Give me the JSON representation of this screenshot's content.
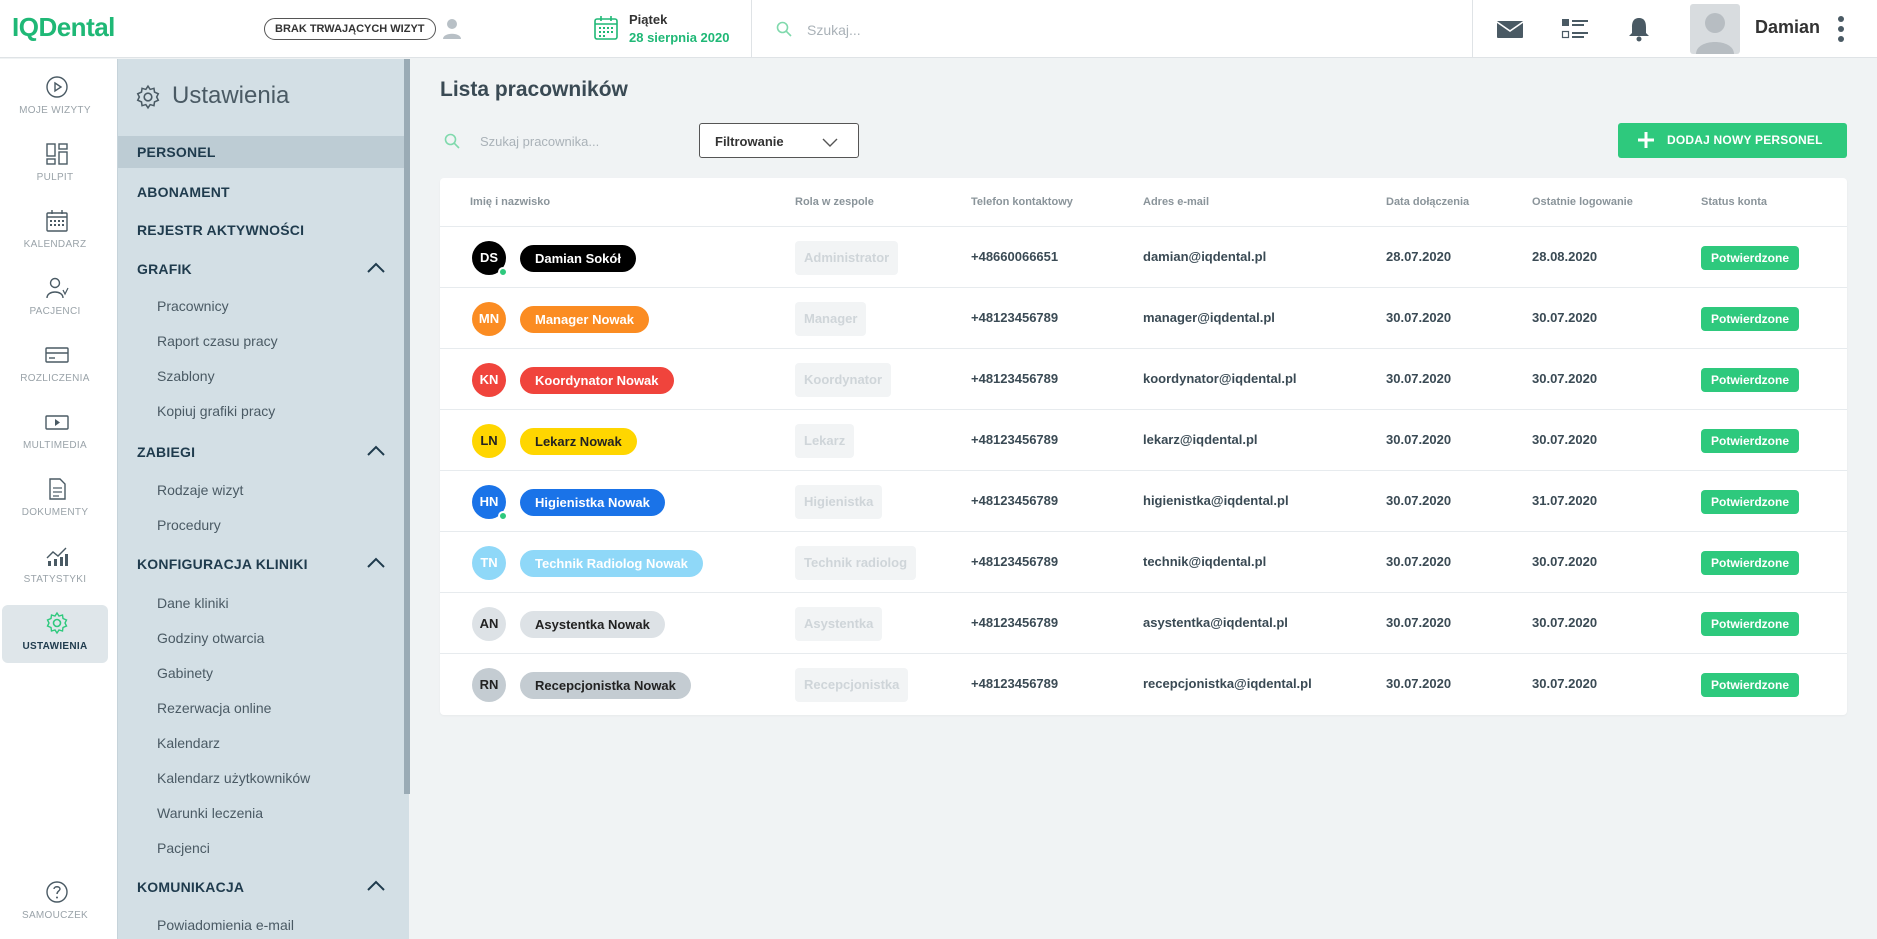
{
  "app": {
    "logo": "IQDental"
  },
  "topbar": {
    "visit_status": "BRAK TRWAJĄCYCH WIZYT",
    "date_day": "Piątek",
    "date_full": "28 sierpnia 2020",
    "search_placeholder": "Szukaj...",
    "username": "Damian"
  },
  "rail": [
    {
      "label": "MOJE WIZYTY",
      "icon": "play-circle-icon"
    },
    {
      "label": "PULPIT",
      "icon": "dashboard-icon"
    },
    {
      "label": "KALENDARZ",
      "icon": "calendar-icon"
    },
    {
      "label": "PACJENCI",
      "icon": "patients-icon"
    },
    {
      "label": "ROZLICZENIA",
      "icon": "card-icon"
    },
    {
      "label": "MULTIMEDIA",
      "icon": "media-icon"
    },
    {
      "label": "DOKUMENTY",
      "icon": "document-icon"
    },
    {
      "label": "STATYSTYKI",
      "icon": "stats-icon"
    },
    {
      "label": "USTAWIENIA",
      "icon": "gear-icon",
      "active": true
    },
    {
      "label": "SAMOUCZEK",
      "icon": "help-icon"
    }
  ],
  "settings": {
    "title": "Ustawienia",
    "sections": {
      "personel": "PERSONEL",
      "abonament": "ABONAMENT",
      "rejestr": "REJESTR AKTYWNOŚCI",
      "grafik": "GRAFIK",
      "zabiegi": "ZABIEGI",
      "konfiguracja": "KONFIGURACJA KLINIKI",
      "komunikacja": "KOMUNIKACJA"
    },
    "grafik_items": [
      "Pracownicy",
      "Raport czasu pracy",
      "Szablony",
      "Kopiuj grafiki pracy"
    ],
    "zabiegi_items": [
      "Rodzaje wizyt",
      "Procedury"
    ],
    "konfiguracja_items": [
      "Dane kliniki",
      "Godziny otwarcia",
      "Gabinety",
      "Rezerwacja online",
      "Kalendarz",
      "Kalendarz użytkowników",
      "Warunki leczenia",
      "Pacjenci"
    ],
    "komunikacja_items": [
      "Powiadomienia e-mail"
    ]
  },
  "main": {
    "title": "Lista pracowników",
    "search_placeholder": "Szukaj pracownika...",
    "filter_label": "Filtrowanie",
    "add_label": "DODAJ NOWY PERSONEL",
    "columns": [
      "Imię i nazwisko",
      "Rola w zespole",
      "Telefon kontaktowy",
      "Adres e-mail",
      "Data dołączenia",
      "Ostatnie logowanie",
      "Status konta"
    ],
    "rows": [
      {
        "initials": "DS",
        "name": "Damian Sokół",
        "role": "Administrator",
        "phone": "+48660066651",
        "email": "damian@iqdental.pl",
        "joined": "28.07.2020",
        "last_login": "28.08.2020",
        "status": "Potwierdzone",
        "color": "#000000",
        "text_color": "#ffffff",
        "online": true
      },
      {
        "initials": "MN",
        "name": "Manager Nowak",
        "role": "Manager",
        "phone": "+48123456789",
        "email": "manager@iqdental.pl",
        "joined": "30.07.2020",
        "last_login": "30.07.2020",
        "status": "Potwierdzone",
        "color": "#fb8c22",
        "text_color": "#ffffff",
        "online": false
      },
      {
        "initials": "KN",
        "name": "Koordynator Nowak",
        "role": "Koordynator",
        "phone": "+48123456789",
        "email": "koordynator@iqdental.pl",
        "joined": "30.07.2020",
        "last_login": "30.07.2020",
        "status": "Potwierdzone",
        "color": "#f0443c",
        "text_color": "#ffffff",
        "online": false
      },
      {
        "initials": "LN",
        "name": "Lekarz Nowak",
        "role": "Lekarz",
        "phone": "+48123456789",
        "email": "lekarz@iqdental.pl",
        "joined": "30.07.2020",
        "last_login": "30.07.2020",
        "status": "Potwierdzone",
        "color": "#ffd600",
        "text_color": "#222222",
        "online": false
      },
      {
        "initials": "HN",
        "name": "Higienistka Nowak",
        "role": "Higienistka",
        "phone": "+48123456789",
        "email": "higienistka@iqdental.pl",
        "joined": "30.07.2020",
        "last_login": "31.07.2020",
        "status": "Potwierdzone",
        "color": "#1a73e8",
        "text_color": "#ffffff",
        "online": true
      },
      {
        "initials": "TN",
        "name": "Technik Radiolog Nowak",
        "role": "Technik radiolog",
        "phone": "+48123456789",
        "email": "technik@iqdental.pl",
        "joined": "30.07.2020",
        "last_login": "30.07.2020",
        "status": "Potwierdzone",
        "color": "#8fd8f8",
        "text_color": "#ffffff",
        "online": false
      },
      {
        "initials": "AN",
        "name": "Asystentka Nowak",
        "role": "Asystentka",
        "phone": "+48123456789",
        "email": "asystentka@iqdental.pl",
        "joined": "30.07.2020",
        "last_login": "30.07.2020",
        "status": "Potwierdzone",
        "color": "#dde2e6",
        "text_color": "#222222",
        "online": false
      },
      {
        "initials": "RN",
        "name": "Recepcjonistka Nowak",
        "role": "Recepcjonistka",
        "phone": "+48123456789",
        "email": "recepcjonistka@iqdental.pl",
        "joined": "30.07.2020",
        "last_login": "30.07.2020",
        "status": "Potwierdzone",
        "color": "#c4ccd2",
        "text_color": "#222222",
        "online": false
      }
    ]
  },
  "colors": {
    "accent": "#2ec97d",
    "brand": "#1fb876",
    "sidebar": "#d3dfe5"
  }
}
